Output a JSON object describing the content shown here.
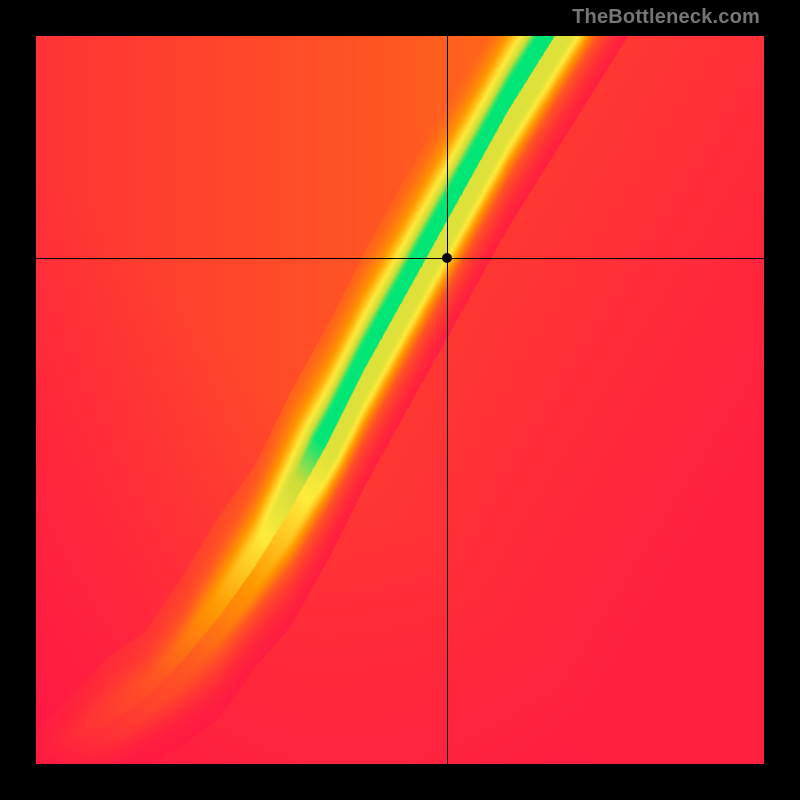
{
  "watermark": {
    "text": "TheBottleneck.com"
  },
  "chart_data": {
    "type": "heatmap",
    "title": "",
    "xlabel": "",
    "ylabel": "",
    "xlim": [
      0,
      1
    ],
    "ylim": [
      0,
      1
    ],
    "crosshair": {
      "x": 0.565,
      "y": 0.695
    },
    "marker": {
      "x": 0.565,
      "y": 0.695
    },
    "optimal_band": {
      "description": "Green optimal-match band through the x-y field; values are (x, y_center, half_width).",
      "points": [
        {
          "x": 0.0,
          "y": 0.0,
          "hw": 0.01
        },
        {
          "x": 0.05,
          "y": 0.025,
          "hw": 0.015
        },
        {
          "x": 0.1,
          "y": 0.055,
          "hw": 0.02
        },
        {
          "x": 0.15,
          "y": 0.09,
          "hw": 0.02
        },
        {
          "x": 0.2,
          "y": 0.14,
          "hw": 0.025
        },
        {
          "x": 0.25,
          "y": 0.2,
          "hw": 0.03
        },
        {
          "x": 0.3,
          "y": 0.27,
          "hw": 0.03
        },
        {
          "x": 0.35,
          "y": 0.35,
          "hw": 0.035
        },
        {
          "x": 0.4,
          "y": 0.44,
          "hw": 0.035
        },
        {
          "x": 0.45,
          "y": 0.54,
          "hw": 0.035
        },
        {
          "x": 0.5,
          "y": 0.63,
          "hw": 0.035
        },
        {
          "x": 0.55,
          "y": 0.72,
          "hw": 0.035
        },
        {
          "x": 0.6,
          "y": 0.81,
          "hw": 0.035
        },
        {
          "x": 0.65,
          "y": 0.9,
          "hw": 0.035
        },
        {
          "x": 0.7,
          "y": 0.98,
          "hw": 0.035
        }
      ]
    },
    "color_stops": {
      "description": "Color ramp from worst match (0) to best (1).",
      "stops": [
        {
          "t": 0.0,
          "color": "#ff1744"
        },
        {
          "t": 0.35,
          "color": "#ff5722"
        },
        {
          "t": 0.55,
          "color": "#ff9800"
        },
        {
          "t": 0.75,
          "color": "#ffeb3b"
        },
        {
          "t": 0.9,
          "color": "#cddc39"
        },
        {
          "t": 1.0,
          "color": "#00e676"
        }
      ]
    }
  }
}
